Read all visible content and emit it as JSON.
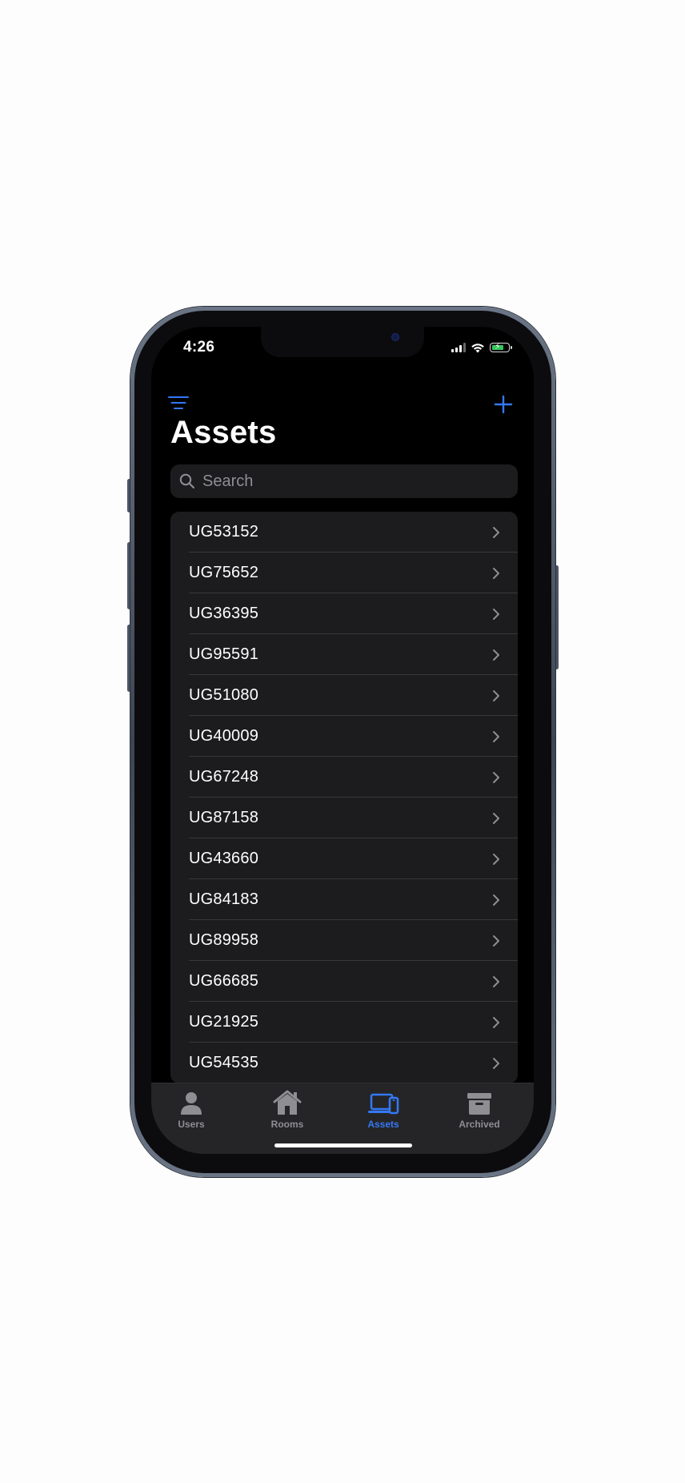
{
  "status_bar": {
    "time": "4:26"
  },
  "nav": {
    "filter_icon": "filter-lines-icon",
    "add_icon": "plus-icon"
  },
  "page": {
    "title": "Assets"
  },
  "search": {
    "placeholder": "Search",
    "value": ""
  },
  "assets": [
    {
      "label": "UG53152"
    },
    {
      "label": "UG75652"
    },
    {
      "label": "UG36395"
    },
    {
      "label": "UG95591"
    },
    {
      "label": "UG51080"
    },
    {
      "label": "UG40009"
    },
    {
      "label": "UG67248"
    },
    {
      "label": "UG87158"
    },
    {
      "label": "UG43660"
    },
    {
      "label": "UG84183"
    },
    {
      "label": "UG89958"
    },
    {
      "label": "UG66685"
    },
    {
      "label": "UG21925"
    },
    {
      "label": "UG54535"
    }
  ],
  "tabs": [
    {
      "label": "Users",
      "icon": "person-icon",
      "active": false
    },
    {
      "label": "Rooms",
      "icon": "house-icon",
      "active": false
    },
    {
      "label": "Assets",
      "icon": "laptop-phone-icon",
      "active": true
    },
    {
      "label": "Archived",
      "icon": "archive-box-icon",
      "active": false
    }
  ],
  "colors": {
    "accent": "#3478f6",
    "background": "#000000",
    "cell": "#1c1c1e",
    "inactive_tab": "#8e8e93"
  }
}
